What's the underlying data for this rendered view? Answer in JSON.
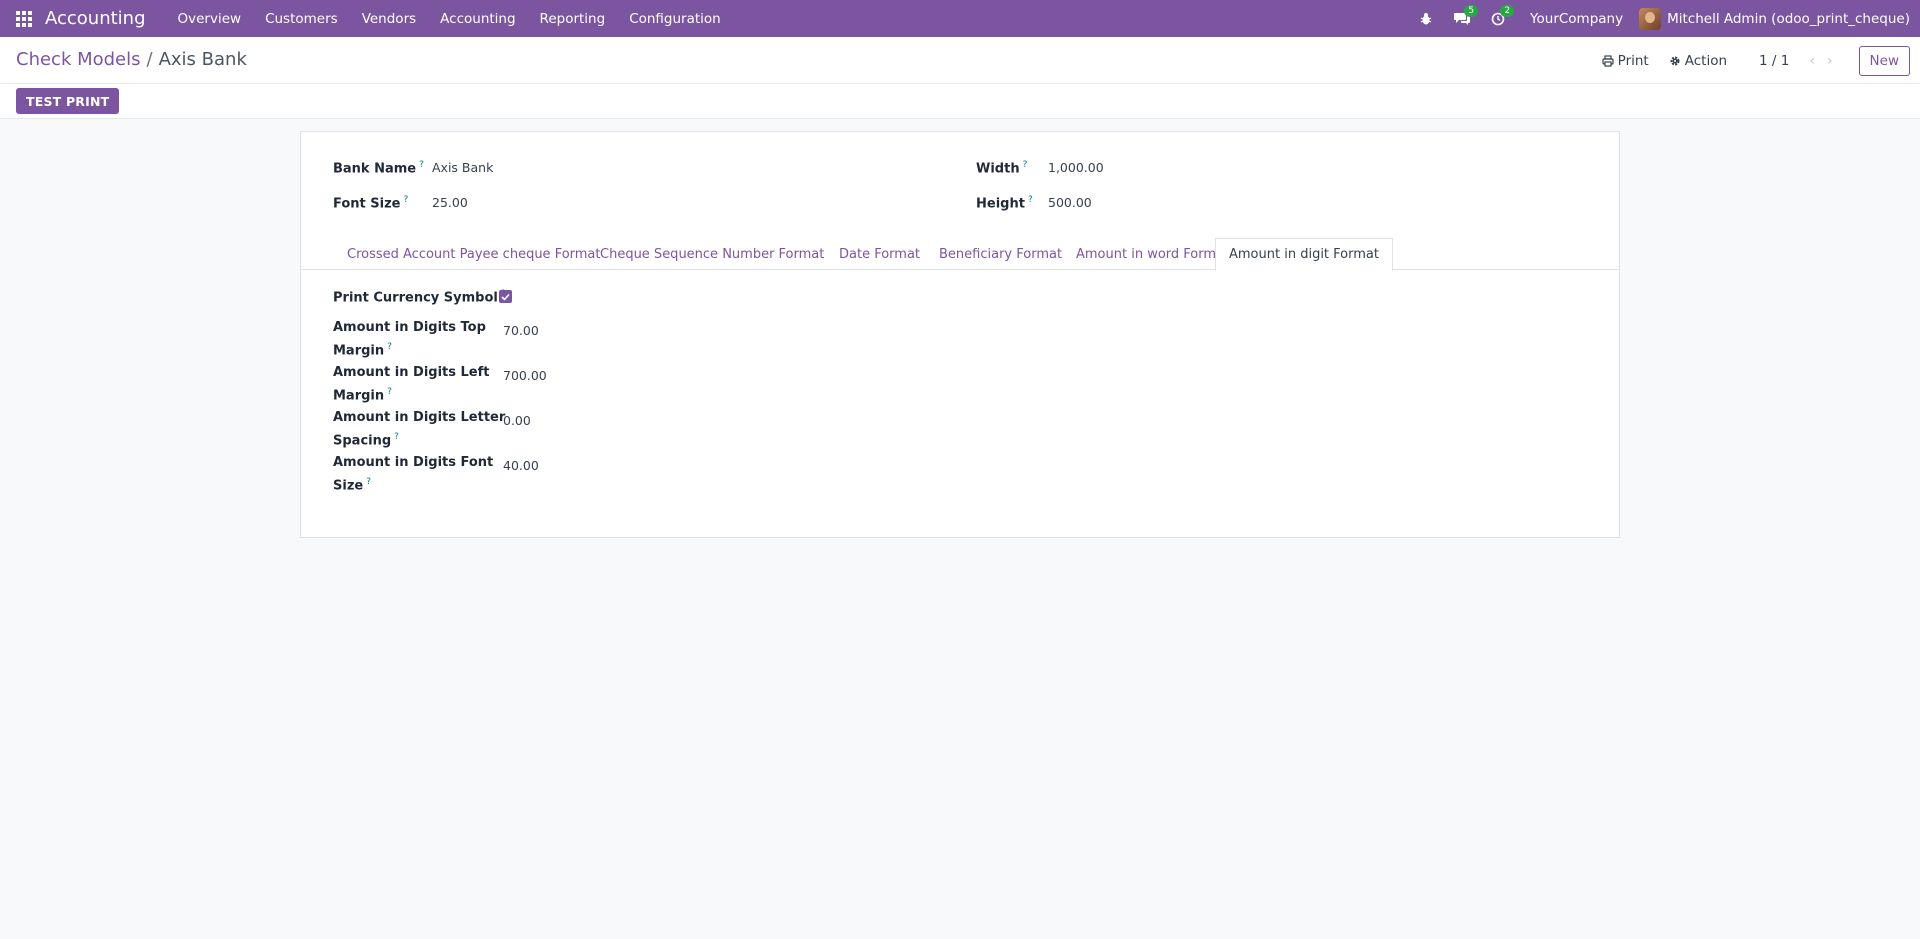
{
  "navbar": {
    "brand": "Accounting",
    "menu": [
      "Overview",
      "Customers",
      "Vendors",
      "Accounting",
      "Reporting",
      "Configuration"
    ],
    "messages_badge": "5",
    "activities_badge": "2",
    "company": "YourCompany",
    "user": "Mitchell Admin (odoo_print_cheque)"
  },
  "control": {
    "breadcrumb_parent": "Check Models",
    "breadcrumb_sep": "/",
    "breadcrumb_current": "Axis Bank",
    "print_label": "Print",
    "action_label": "Action",
    "pager": "1 / 1",
    "new_label": "New"
  },
  "statusbar": {
    "test_print_label": "TEST PRINT"
  },
  "form": {
    "bank_name_label": "Bank Name",
    "bank_name_value": "Axis Bank",
    "font_size_label": "Font Size",
    "font_size_value": "25.00",
    "width_label": "Width",
    "width_value": "1,000.00",
    "height_label": "Height",
    "height_value": "500.00",
    "help_mark": "?"
  },
  "tabs": [
    "Crossed Account Payee cheque Format",
    "Cheque Sequence Number Format",
    "Date Format",
    "Beneficiary Format",
    "Amount in word Format",
    "Amount in digit Format"
  ],
  "digit_tab": {
    "currency_symbol_label": "Print Currency Symbol",
    "currency_symbol_checked": true,
    "top_margin_label_1": "Amount in Digits Top",
    "top_margin_label_2": "Margin",
    "top_margin_value": "70.00",
    "left_margin_label_1": "Amount in Digits Left",
    "left_margin_label_2": "Margin",
    "left_margin_value": "700.00",
    "letter_spacing_label_1": "Amount in Digits Letter",
    "letter_spacing_label_2": "Spacing",
    "letter_spacing_value": "0.00",
    "font_size_label_1": "Amount in Digits Font",
    "font_size_label_2": "Size",
    "font_size_value": "40.00"
  },
  "colors": {
    "brand": "#7c55a0",
    "help": "#017e84",
    "badge": "#28a745"
  }
}
